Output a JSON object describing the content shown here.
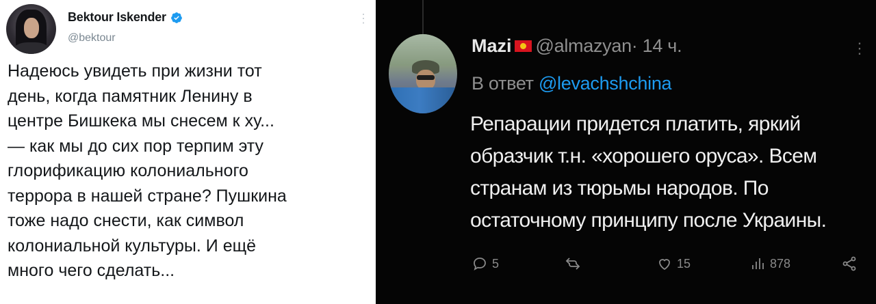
{
  "left_tweet": {
    "author_name": "Bektour Iskender",
    "author_handle": "@bektour",
    "text_lines": [
      "Надеюсь увидеть при жизни тот",
      "день, когда памятник Ленину в",
      "центре Бишкека мы снесем к ху...",
      "— как мы до сих пор терпим эту",
      "глорификацию колониального",
      "террора в нашей стране? Пушкина",
      "тоже надо снести, как символ",
      "колониальной культуры. И ещё",
      "много чего сделать..."
    ],
    "verified_color": "#1d9bf0"
  },
  "right_tweet": {
    "author_name": "Mazi",
    "author_handle": "@almazyan",
    "time": " · 14 ч.",
    "reply_prefix": "В ответ ",
    "reply_mention": "@levachshchina",
    "text_lines": [
      "Репарации придется платить, яркий",
      "образчик т.н. «хорошего оруса». Всем",
      "странам из тюрьмы народов. По",
      "остаточному принципу после Украины."
    ],
    "actions": {
      "replies": "5",
      "retweets": "",
      "likes": "15",
      "views": "878"
    },
    "accent_color": "#1d9bf0"
  }
}
